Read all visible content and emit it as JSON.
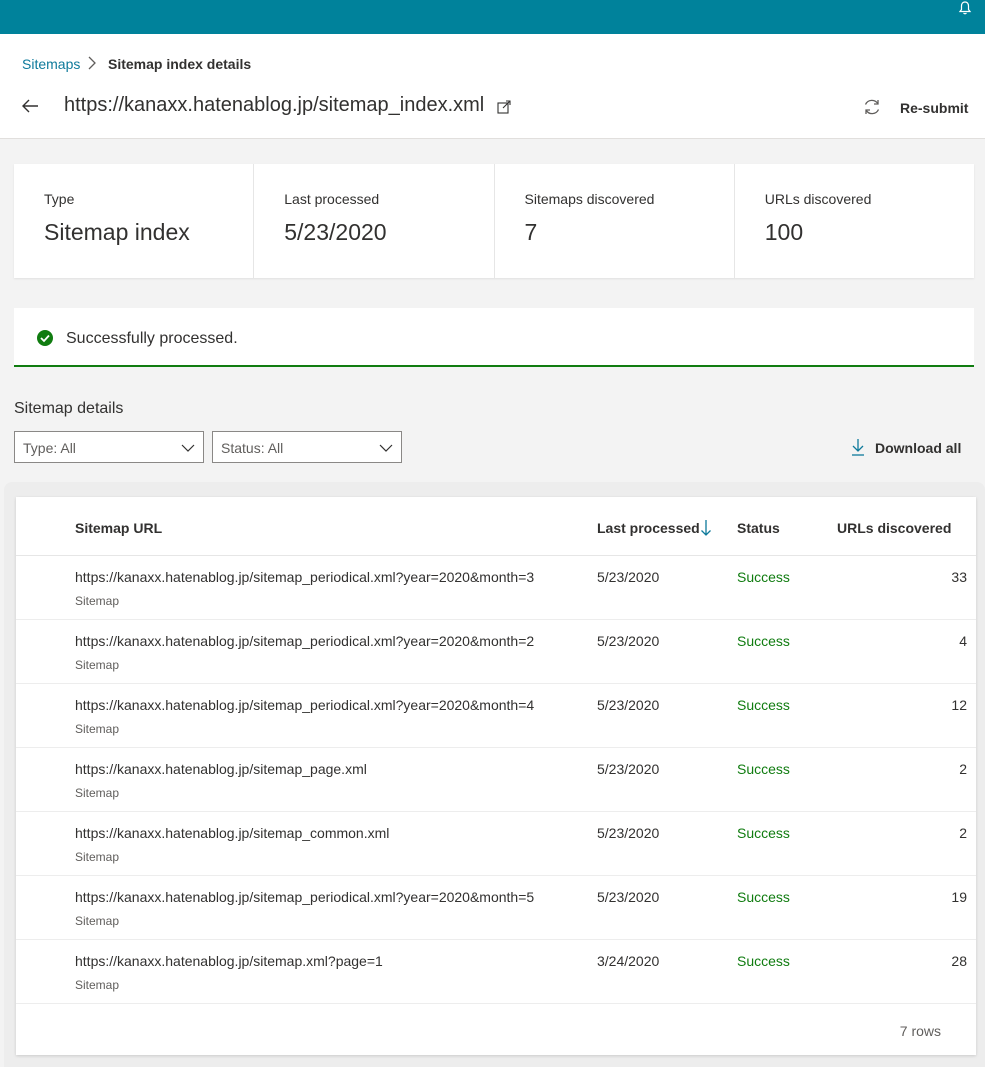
{
  "breadcrumb": {
    "parent": "Sitemaps",
    "current": "Sitemap index details"
  },
  "header": {
    "url": "https://kanaxx.hatenablog.jp/sitemap_index.xml",
    "resubmit_label": "Re-submit"
  },
  "summary": [
    {
      "label": "Type",
      "value": "Sitemap index"
    },
    {
      "label": "Last processed",
      "value": "5/23/2020"
    },
    {
      "label": "Sitemaps discovered",
      "value": "7"
    },
    {
      "label": "URLs discovered",
      "value": "100"
    }
  ],
  "status_message": "Successfully processed.",
  "details": {
    "title": "Sitemap details",
    "type_filter": "Type: All",
    "status_filter": "Status: All",
    "download_label": "Download all"
  },
  "table": {
    "headers": {
      "url": "Sitemap URL",
      "last_processed": "Last processed",
      "status": "Status",
      "urls": "URLs discovered"
    },
    "rows": [
      {
        "url": "https://kanaxx.hatenablog.jp/sitemap_periodical.xml?year=2020&month=3",
        "type": "Sitemap",
        "date": "5/23/2020",
        "status": "Success",
        "count": "33"
      },
      {
        "url": "https://kanaxx.hatenablog.jp/sitemap_periodical.xml?year=2020&month=2",
        "type": "Sitemap",
        "date": "5/23/2020",
        "status": "Success",
        "count": "4"
      },
      {
        "url": "https://kanaxx.hatenablog.jp/sitemap_periodical.xml?year=2020&month=4",
        "type": "Sitemap",
        "date": "5/23/2020",
        "status": "Success",
        "count": "12"
      },
      {
        "url": "https://kanaxx.hatenablog.jp/sitemap_page.xml",
        "type": "Sitemap",
        "date": "5/23/2020",
        "status": "Success",
        "count": "2"
      },
      {
        "url": "https://kanaxx.hatenablog.jp/sitemap_common.xml",
        "type": "Sitemap",
        "date": "5/23/2020",
        "status": "Success",
        "count": "2"
      },
      {
        "url": "https://kanaxx.hatenablog.jp/sitemap_periodical.xml?year=2020&month=5",
        "type": "Sitemap",
        "date": "5/23/2020",
        "status": "Success",
        "count": "19"
      },
      {
        "url": "https://kanaxx.hatenablog.jp/sitemap.xml?page=1",
        "type": "Sitemap",
        "date": "3/24/2020",
        "status": "Success",
        "count": "28"
      }
    ],
    "row_count": "7 rows"
  },
  "colors": {
    "topbar": "#00829b",
    "link": "#0e7a9b",
    "success": "#107c10"
  },
  "icons": [
    "bell-icon",
    "chevron-right-icon",
    "back-arrow-icon",
    "external-link-icon",
    "refresh-icon",
    "check-circle-icon",
    "chevron-down-icon",
    "download-icon",
    "sort-down-icon"
  ]
}
